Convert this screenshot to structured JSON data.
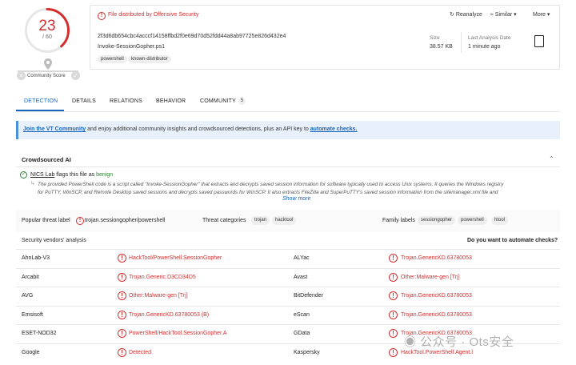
{
  "score": {
    "detections": "23",
    "total": "/ 60",
    "fraction": 0.3833
  },
  "community": {
    "label": "Community Score",
    "down": "×",
    "up": "✓"
  },
  "header": {
    "distributed_by": "File distributed by Offensive Security",
    "hash": "2f3d6db654cbc4acccf14158ffbd2f0e69d70d52fdd44a8ab97725e826d432e4",
    "filename": "Invoke-SessionGopher.ps1",
    "tags": [
      "powershell",
      "known-distributor"
    ],
    "actions": {
      "reanalyze": "Reanalyze",
      "similar": "Similar",
      "more": "More"
    },
    "size_label": "Size",
    "size_value": "38.57 KB",
    "last_label": "Last Analysis Date",
    "last_value": "1 minute ago"
  },
  "tabs": [
    {
      "label": "DETECTION"
    },
    {
      "label": "DETAILS"
    },
    {
      "label": "RELATIONS"
    },
    {
      "label": "BEHAVIOR"
    },
    {
      "label": "COMMUNITY",
      "count": "5"
    }
  ],
  "banner": {
    "link1": "Join the VT Community",
    "text": " and enjoy additional community insights and crowdsourced detections, plus an API key to ",
    "link2": "automate checks."
  },
  "ai": {
    "title": "Crowdsourced AI",
    "source": "NICS Lab",
    "flags_text": " flags this file as ",
    "verdict": "benign",
    "line1": "The provided PowerShell code is a script called \"Invoke-SessionGopher\" that extracts and decrypts saved session information for software typically used to access Unix systems. It queries the Windows registry",
    "line2": "for PuTTY, WinSCP, and Remote Desktop saved sessions and decrypts saved passwords for WinSCP. It also extracts FileZilla and SuperPuTTY's saved session information from the sitemanager.xml file and",
    "show_more": "Show more"
  },
  "threat": {
    "popular_label": "Popular threat label",
    "popular_value": "trojan.sessiongopher/powershell",
    "categories_label": "Threat categories",
    "categories": [
      "trojan",
      "hacktool"
    ],
    "family_label": "Family labels",
    "families": [
      "sessiongopher",
      "powershell",
      "htool"
    ]
  },
  "vendors": {
    "title": "Security vendors' analysis",
    "automate": "Do you want to automate checks?",
    "rows": [
      {
        "left": {
          "name": "AhnLab-V3",
          "result": "HackTool/PowerShell.SessionGopher"
        },
        "right": {
          "name": "ALYac",
          "result": "Trojan.GenericKD.63780053"
        }
      },
      {
        "left": {
          "name": "Arcabit",
          "result": "Trojan.Generic.D3CD34D5"
        },
        "right": {
          "name": "Avast",
          "result": "Other:Malware-gen [Trj]"
        }
      },
      {
        "left": {
          "name": "AVG",
          "result": "Other:Malware-gen [Trj]"
        },
        "right": {
          "name": "BitDefender",
          "result": "Trojan.GenericKD.63780053"
        }
      },
      {
        "left": {
          "name": "Emsisoft",
          "result": "Trojan.GenericKD.63780053 (B)"
        },
        "right": {
          "name": "eScan",
          "result": "Trojan.GenericKD.63780053"
        }
      },
      {
        "left": {
          "name": "ESET-NOD32",
          "result": "PowerShell/HackTool.SessionGopher.A"
        },
        "right": {
          "name": "GData",
          "result": "Trojan.GenericKD.63780053"
        }
      },
      {
        "left": {
          "name": "Google",
          "result": "Detected"
        },
        "right": {
          "name": "Kaspersky",
          "result": "HackTool.PowerShell.Agent.l"
        }
      }
    ]
  },
  "watermark": "公众号 · Ots安全"
}
